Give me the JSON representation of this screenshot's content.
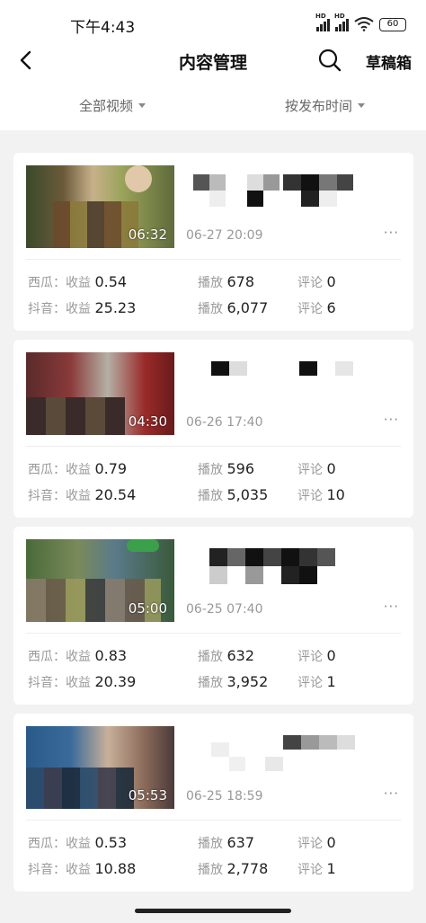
{
  "status_bar": {
    "time": "下午4:43",
    "signal_1": "HD",
    "signal_2": "HD",
    "battery": "60"
  },
  "nav": {
    "title": "内容管理",
    "drafts_label": "草稿箱"
  },
  "filters": {
    "all_videos": "全部视频",
    "sort": "按发布时间"
  },
  "labels": {
    "xigua": "西瓜：",
    "douyin": "抖音：",
    "revenue": "收益",
    "plays": "播放",
    "comments": "评论",
    "more": "···"
  },
  "videos": [
    {
      "duration": "06:32",
      "date": "06-27 20:09",
      "xigua": {
        "revenue": "0.54",
        "plays": "678",
        "comments": "0"
      },
      "douyin": {
        "revenue": "25.23",
        "plays": "6,077",
        "comments": "6"
      }
    },
    {
      "duration": "04:30",
      "date": "06-26 17:40",
      "xigua": {
        "revenue": "0.79",
        "plays": "596",
        "comments": "0"
      },
      "douyin": {
        "revenue": "20.54",
        "plays": "5,035",
        "comments": "10"
      }
    },
    {
      "duration": "05:00",
      "date": "06-25 07:40",
      "xigua": {
        "revenue": "0.83",
        "plays": "632",
        "comments": "0"
      },
      "douyin": {
        "revenue": "20.39",
        "plays": "3,952",
        "comments": "1"
      }
    },
    {
      "duration": "05:53",
      "date": "06-25 18:59",
      "xigua": {
        "revenue": "0.53",
        "plays": "637",
        "comments": "0"
      },
      "douyin": {
        "revenue": "10.88",
        "plays": "2,778",
        "comments": "1"
      }
    }
  ]
}
